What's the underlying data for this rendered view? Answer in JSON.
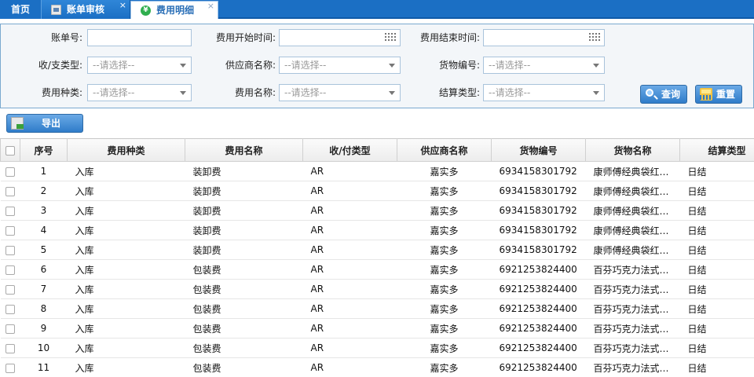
{
  "tabs": {
    "home": "首页",
    "bill_audit": "账单审核",
    "fee_detail": "费用明细",
    "close_glyph": "×"
  },
  "filters": {
    "bill_no_label": "账单号:",
    "fee_start_label": "费用开始时间:",
    "fee_end_label": "费用结束时间:",
    "in_out_type_label": "收/支类型:",
    "supplier_name_label": "供应商名称:",
    "goods_no_label": "货物编号:",
    "fee_kind_label": "费用种类:",
    "fee_name_label": "费用名称:",
    "settle_type_label": "结算类型:",
    "select_placeholder": "--请选择--"
  },
  "buttons": {
    "query": "查询",
    "reset": "重置",
    "export": "导出"
  },
  "table": {
    "columns": [
      "序号",
      "费用种类",
      "费用名称",
      "收/付类型",
      "供应商名称",
      "货物编号",
      "货物名称",
      "结算类型"
    ],
    "rows": [
      [
        "1",
        "入库",
        "装卸费",
        "AR",
        "嘉实多",
        "6934158301792",
        "康师傅经典袋红…",
        "日结"
      ],
      [
        "2",
        "入库",
        "装卸费",
        "AR",
        "嘉实多",
        "6934158301792",
        "康师傅经典袋红…",
        "日结"
      ],
      [
        "3",
        "入库",
        "装卸费",
        "AR",
        "嘉实多",
        "6934158301792",
        "康师傅经典袋红…",
        "日结"
      ],
      [
        "4",
        "入库",
        "装卸费",
        "AR",
        "嘉实多",
        "6934158301792",
        "康师傅经典袋红…",
        "日结"
      ],
      [
        "5",
        "入库",
        "装卸费",
        "AR",
        "嘉实多",
        "6934158301792",
        "康师傅经典袋红…",
        "日结"
      ],
      [
        "6",
        "入库",
        "包装费",
        "AR",
        "嘉实多",
        "6921253824400",
        "百芬巧克力法式…",
        "日结"
      ],
      [
        "7",
        "入库",
        "包装费",
        "AR",
        "嘉实多",
        "6921253824400",
        "百芬巧克力法式…",
        "日结"
      ],
      [
        "8",
        "入库",
        "包装费",
        "AR",
        "嘉实多",
        "6921253824400",
        "百芬巧克力法式…",
        "日结"
      ],
      [
        "9",
        "入库",
        "包装费",
        "AR",
        "嘉实多",
        "6921253824400",
        "百芬巧克力法式…",
        "日结"
      ],
      [
        "10",
        "入库",
        "包装费",
        "AR",
        "嘉实多",
        "6921253824400",
        "百芬巧克力法式…",
        "日结"
      ],
      [
        "11",
        "入库",
        "包装费",
        "AR",
        "嘉实多",
        "6921253824400",
        "百芬巧克力法式…",
        "日结"
      ]
    ]
  }
}
